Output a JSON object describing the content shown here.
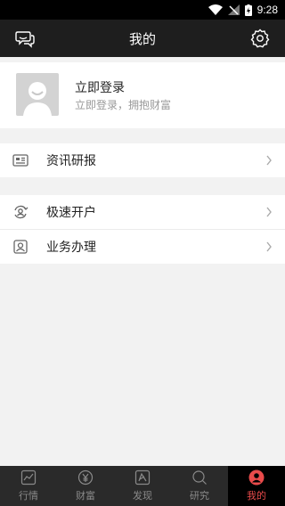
{
  "status_bar": {
    "time": "9:28"
  },
  "header": {
    "title": "我的",
    "left_icon": "chat-icon",
    "right_icon": "gear-icon"
  },
  "profile": {
    "name": "立即登录",
    "subtitle": "立即登录，拥抱财富"
  },
  "menu": [
    {
      "label": "资讯研报",
      "icon": "news-icon"
    },
    {
      "label": "极速开户",
      "icon": "account-open-icon"
    },
    {
      "label": "业务办理",
      "icon": "business-icon"
    }
  ],
  "tabs": [
    {
      "label": "行情",
      "icon": "market-icon",
      "active": false
    },
    {
      "label": "财富",
      "icon": "wealth-icon",
      "active": false
    },
    {
      "label": "发现",
      "icon": "discover-icon",
      "active": false
    },
    {
      "label": "研究",
      "icon": "research-icon",
      "active": false
    },
    {
      "label": "我的",
      "icon": "user-icon",
      "active": true
    }
  ],
  "colors": {
    "accent": "#e94b4b",
    "header_bg": "#1e1e1e",
    "tabbar_bg": "#2a2a2a"
  }
}
